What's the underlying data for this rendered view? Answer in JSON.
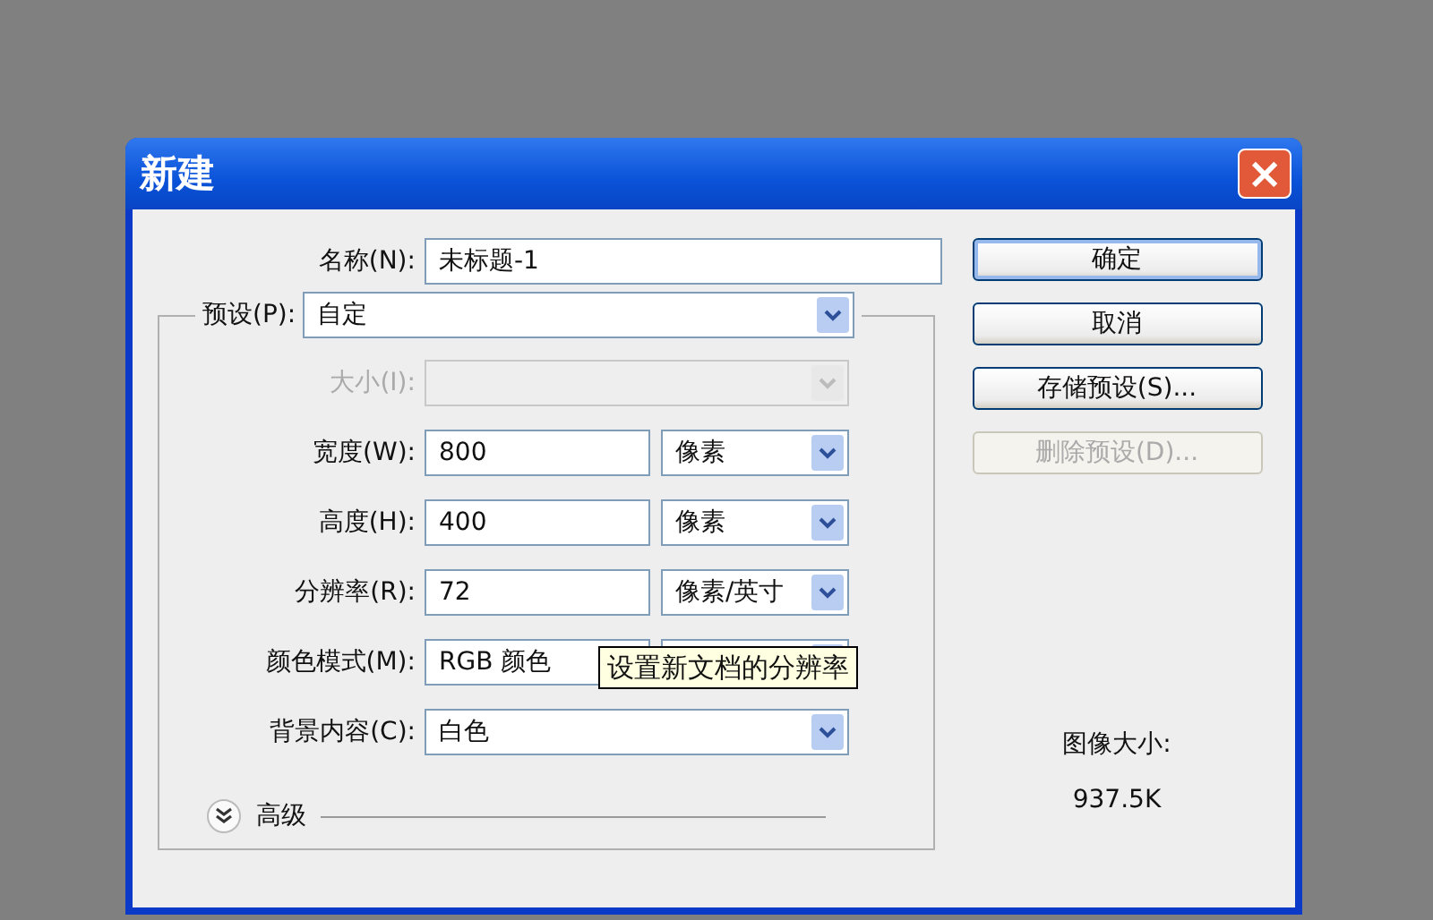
{
  "window": {
    "title": "新建",
    "close": "×"
  },
  "name": {
    "label": "名称(N):",
    "value": "未标题-1"
  },
  "preset": {
    "label": "预设(P):",
    "value": "自定"
  },
  "rows": [
    {
      "kind": "select",
      "label": "大小(I):",
      "value": "",
      "disabled": true
    },
    {
      "kind": "number",
      "label": "宽度(W):",
      "value": "800",
      "unit": "像素",
      "disabled": false
    },
    {
      "kind": "number",
      "label": "高度(H):",
      "value": "400",
      "unit": "像素",
      "disabled": false
    },
    {
      "kind": "number",
      "label": "分辨率(R):",
      "value": "72",
      "unit": "像素/英寸",
      "disabled": false
    },
    {
      "kind": "pair",
      "label": "颜色模式(M):",
      "value": "RGB 颜色",
      "unit": "",
      "disabled": false
    },
    {
      "kind": "select",
      "label": "背景内容(C):",
      "value": "白色",
      "disabled": false
    }
  ],
  "tooltip": "设置新文档的分辨率",
  "advanced": {
    "label": "高级",
    "expanded": false
  },
  "buttons": [
    {
      "label": "确定",
      "disabled": false,
      "default": true
    },
    {
      "label": "取消",
      "disabled": false,
      "default": false
    },
    {
      "label": "存储预设(S)...",
      "disabled": false,
      "default": false
    },
    {
      "label": "删除预设(D)...",
      "disabled": true,
      "default": false
    }
  ],
  "image_size": {
    "label": "图像大小:",
    "value": "937.5K"
  }
}
